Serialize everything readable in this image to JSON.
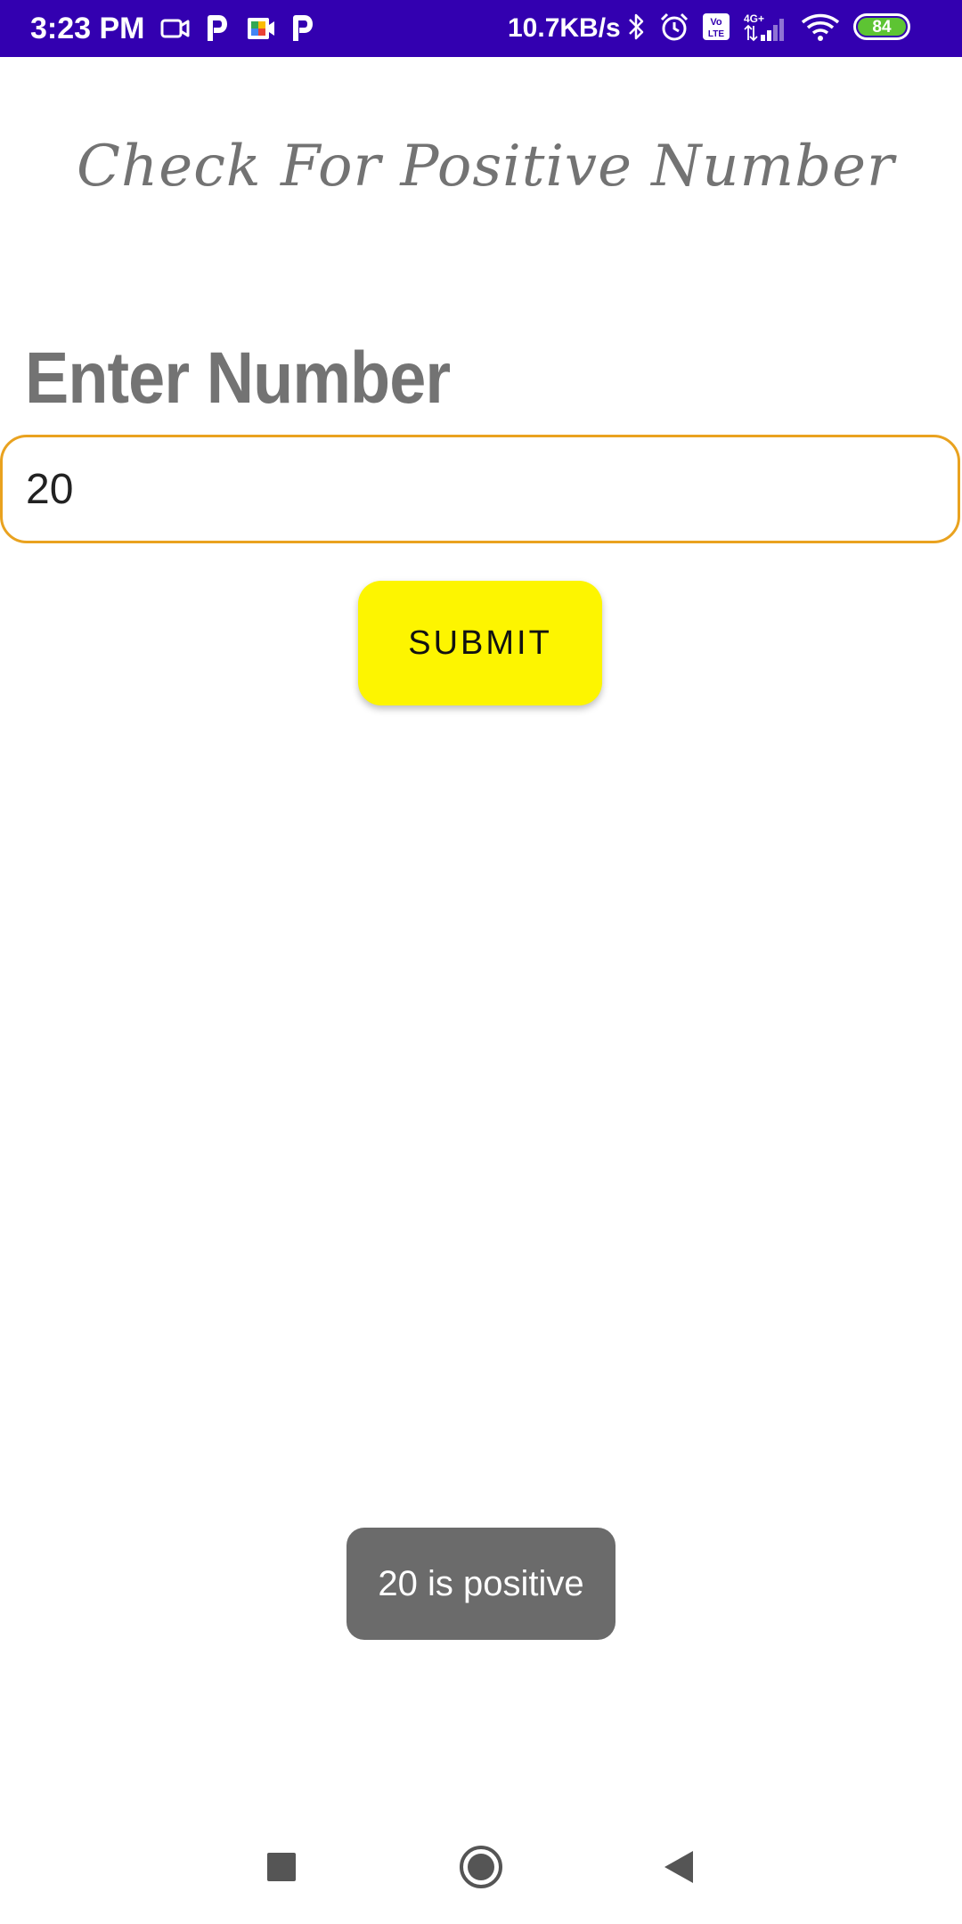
{
  "status_bar": {
    "time": "3:23 PM",
    "network_speed": "10.7KB/s",
    "battery_level": "84",
    "left_icons": [
      "video-call-icon",
      "paytm-p-icon",
      "google-meet-icon",
      "paytm-p-icon"
    ],
    "right_icons": [
      "bluetooth-icon",
      "alarm-icon",
      "volte-icon",
      "signal-4g-icon",
      "wifi-icon",
      "battery-icon"
    ],
    "volte_label": "Vo LTE",
    "network_type": "4G+",
    "color": "#3300b0"
  },
  "app": {
    "title": "Check For Positive Number",
    "input_label": "Enter Number",
    "input_value": "20",
    "submit_label": "SUBMIT",
    "toast_message": "20 is positive",
    "accent_border_color": "#e9a21f",
    "button_color": "#fdf500"
  },
  "nav_bar": {
    "buttons": [
      "recents-icon",
      "home-icon",
      "back-icon"
    ]
  }
}
